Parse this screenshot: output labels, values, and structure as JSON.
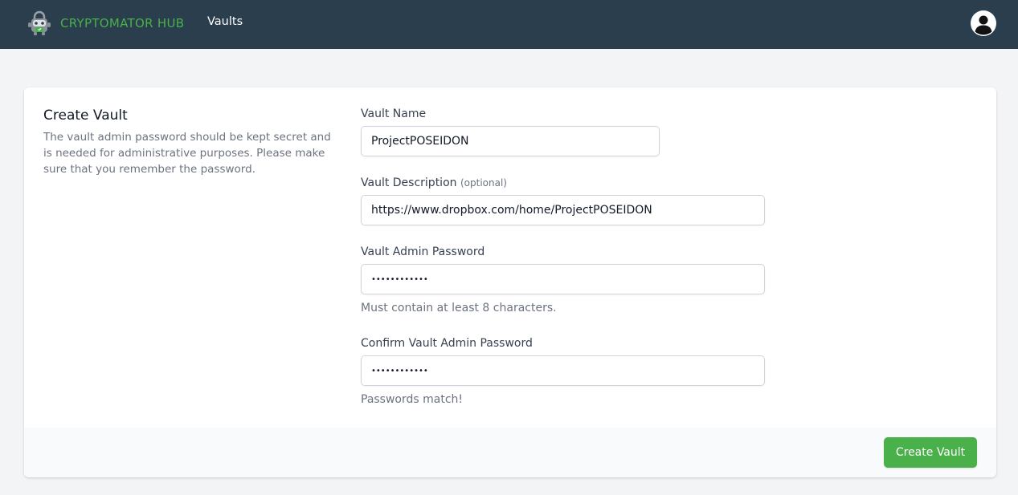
{
  "navbar": {
    "brand": "CRYPTOMATOR HUB",
    "logo_icon": "cryptomator-bot-icon",
    "links": [
      "Vaults"
    ],
    "avatar_icon": "user-circle-icon",
    "background": "#2b3e4e",
    "brand_color": "#49b04a"
  },
  "intro": {
    "title": "Create Vault",
    "description": "The vault admin password should be kept secret and is needed for administrative purposes. Please make sure that you remember the password."
  },
  "form": {
    "vault_name": {
      "label": "Vault Name",
      "value": "ProjectPOSEIDON"
    },
    "vault_description": {
      "label": "Vault Description",
      "optional": "(optional)",
      "value": "https://www.dropbox.com/home/ProjectPOSEIDON"
    },
    "admin_password": {
      "label": "Vault Admin Password",
      "value": "••••••••••••",
      "hint": "Must contain at least 8 characters."
    },
    "confirm_password": {
      "label": "Confirm Vault Admin Password",
      "value": "••••••••••••",
      "hint": "Passwords match!"
    }
  },
  "footer": {
    "submit_label": "Create Vault",
    "accent": "#49b04a"
  }
}
